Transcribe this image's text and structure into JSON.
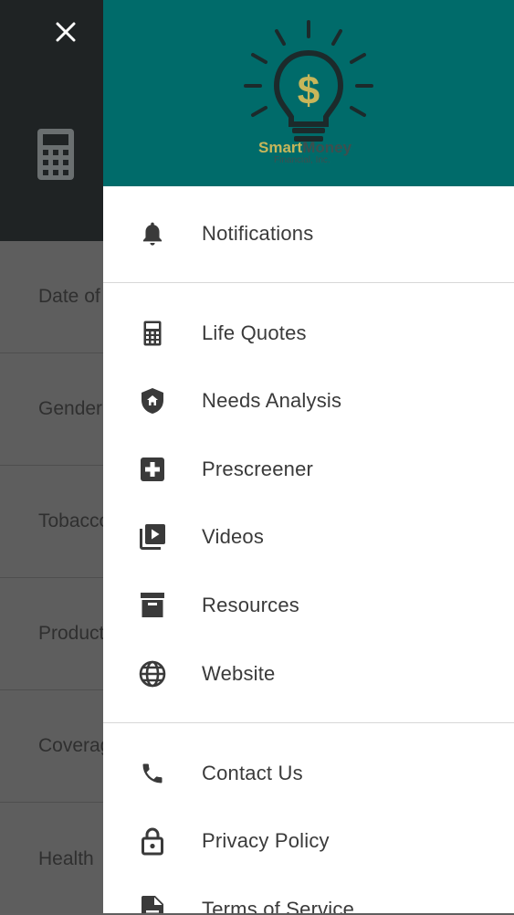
{
  "background": {
    "rows": [
      "Date of",
      "Gender",
      "Tobacco",
      "Product",
      "Coverage",
      "Health"
    ]
  },
  "drawer": {
    "logo": {
      "brand_part1": "Smart",
      "brand_part2": "Money",
      "subtitle": "Financial, Inc."
    },
    "sections": [
      {
        "items": [
          {
            "label": "Notifications",
            "icon": "bell-icon"
          }
        ]
      },
      {
        "items": [
          {
            "label": "Life Quotes",
            "icon": "calculator-icon"
          },
          {
            "label": "Needs Analysis",
            "icon": "shield-home-icon"
          },
          {
            "label": "Prescreener",
            "icon": "medical-plus-icon"
          },
          {
            "label": "Videos",
            "icon": "video-library-icon"
          },
          {
            "label": "Resources",
            "icon": "archive-box-icon"
          },
          {
            "label": "Website",
            "icon": "globe-icon"
          }
        ]
      },
      {
        "items": [
          {
            "label": "Contact Us",
            "icon": "phone-icon"
          },
          {
            "label": "Privacy Policy",
            "icon": "lock-icon"
          },
          {
            "label": "Terms of Service",
            "icon": "document-icon"
          }
        ]
      }
    ]
  },
  "colors": {
    "header": "#006b6a",
    "brand_gold": "#c7b65a",
    "overlay_dark": "#1f2324"
  }
}
